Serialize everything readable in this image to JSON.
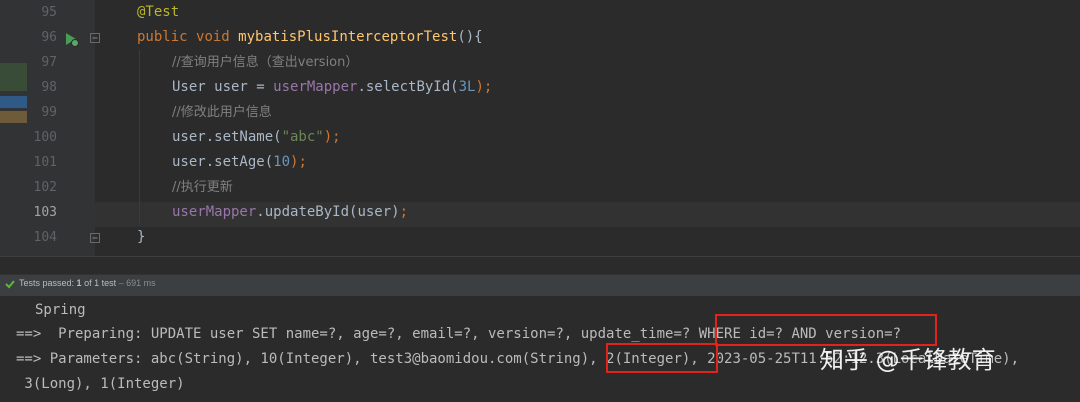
{
  "editor": {
    "lines": [
      {
        "num": "95",
        "segments": [
          {
            "text": "@Test",
            "cls": "ann"
          }
        ]
      },
      {
        "num": "96",
        "segments": [
          {
            "text": "public ",
            "cls": "kw"
          },
          {
            "text": "void ",
            "cls": "kw"
          },
          {
            "text": "mybatisPlusInterceptorTest",
            "cls": "fn"
          },
          {
            "text": "(){",
            "cls": ""
          }
        ]
      },
      {
        "num": "97",
        "segments": [
          {
            "text": "//查询用户信息（查出version）",
            "cls": "cmt"
          }
        ]
      },
      {
        "num": "98",
        "segments": [
          {
            "text": "User user = ",
            "cls": ""
          },
          {
            "text": "userMapper",
            "cls": "fld"
          },
          {
            "text": ".selectById(",
            "cls": ""
          },
          {
            "text": "3L",
            "cls": "num"
          },
          {
            "text": ");",
            "cls": "kw"
          }
        ]
      },
      {
        "num": "99",
        "segments": [
          {
            "text": "//修改此用户信息",
            "cls": "cmt"
          }
        ]
      },
      {
        "num": "100",
        "segments": [
          {
            "text": "user.setName(",
            "cls": ""
          },
          {
            "text": "\"abc\"",
            "cls": "str"
          },
          {
            "text": ");",
            "cls": "kw"
          }
        ]
      },
      {
        "num": "101",
        "segments": [
          {
            "text": "user.setAge(",
            "cls": ""
          },
          {
            "text": "10",
            "cls": "num"
          },
          {
            "text": ");",
            "cls": "kw"
          }
        ]
      },
      {
        "num": "102",
        "segments": [
          {
            "text": "//执行更新",
            "cls": "cmt"
          }
        ]
      },
      {
        "num": "103",
        "segments": [
          {
            "text": "userMapper",
            "cls": "fld"
          },
          {
            "text": ".updateById(user)",
            "cls": ""
          },
          {
            "text": ";",
            "cls": "kw"
          }
        ]
      },
      {
        "num": "104",
        "segments": [
          {
            "text": "}",
            "cls": ""
          }
        ]
      }
    ],
    "current_line": "103"
  },
  "test_status": {
    "label": "Tests passed:",
    "passed": "1",
    "rest": " of 1 test",
    "duration": " – 691 ms"
  },
  "console": {
    "line1": "Spring",
    "line2": "==>  Preparing: UPDATE user SET name=?, age=?, email=?, version=?, update_time=? WHERE id=? AND version=?",
    "line3": "==> Parameters: abc(String), 10(Integer), test3@baomidou.com(String), 2(Integer), 2023-05-25T11:52:12.3(LocalDateTime),",
    "line4": " 3(Long), 1(Integer)"
  },
  "watermark": "知乎 @千锋教育",
  "colors": {
    "highlight_box": "#e2231a",
    "test_passed": "#5fb832"
  }
}
